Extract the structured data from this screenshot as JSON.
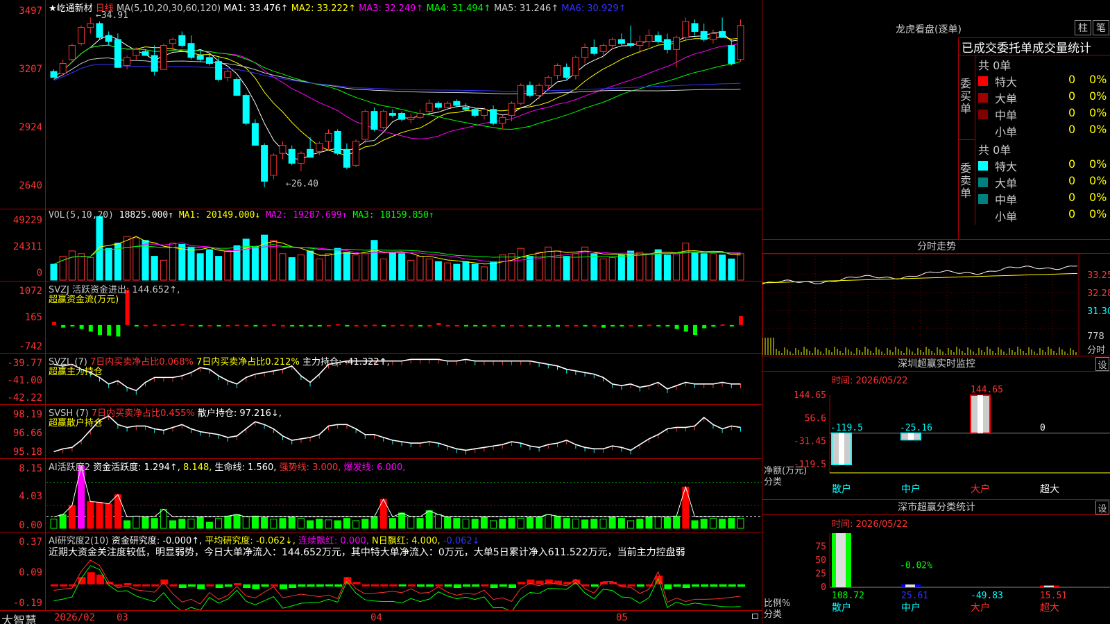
{
  "main": {
    "stock": "★屹通新材",
    "period": "日线",
    "ma_title": "MA(5,10,20,30,60,120)",
    "ma": [
      {
        "label": "MA1: 33.476↑",
        "color": "#ffffff"
      },
      {
        "label": "MA2: 33.222↑",
        "color": "#ffff00"
      },
      {
        "label": "MA3: 32.249↑",
        "color": "#ff00ff"
      },
      {
        "label": "MA4: 31.494↑",
        "color": "#00ff00"
      },
      {
        "label": "MA5: 31.246↑",
        "color": "#cccccc"
      },
      {
        "label": "MA6: 30.929↑",
        "color": "#3333ff"
      }
    ],
    "yticks": [
      "3497",
      "3207",
      "2924",
      "2640"
    ],
    "high_note": "34.91",
    "low_note": "26.40"
  },
  "volume": {
    "title": "VOL(5,10,20)",
    "value": "18825.000↑",
    "ma": [
      {
        "label": "MA1: 20149.000↓",
        "color": "#ffff00"
      },
      {
        "label": "MA2: 19287.699↑",
        "color": "#ff00ff"
      },
      {
        "label": "MA3: 18159.850↑",
        "color": "#00ff00"
      }
    ],
    "yticks": [
      "49229",
      "24311",
      "0"
    ]
  },
  "svzj": {
    "title": "SVZJ  活跃资金进出: 144.652↑,",
    "subtitle": "超赢资金流(万元)",
    "yticks": [
      "1072",
      "165",
      "-742"
    ]
  },
  "svzl": {
    "title": "SVZL (7)",
    "item1": "7日内买卖净占比0.068%",
    "item2": "7日内买卖净占比0.212%",
    "item3": "主力持仓: -41.322↑,",
    "subtitle": "超赢主力持仓",
    "yticks": [
      "-39.77",
      "-41.00",
      "-42.22"
    ]
  },
  "svsh": {
    "title": "SVSH (7)",
    "item1": "7日内买卖净占比0.455%",
    "item2": "散户持仓: 97.216↓,",
    "subtitle": "超赢散户持仓",
    "yticks": [
      "98.19",
      "96.66",
      "95.18"
    ]
  },
  "ai1": {
    "title": "AI活跃度2",
    "item1": "资金活跃度: 1.294↑,",
    "item2": "8.148,",
    "item3": "生命线: 1.560,",
    "item4": "强势线: 3.000,",
    "item5": "爆发线: 6.000,",
    "yticks": [
      "8.15",
      "4.03",
      "0.00"
    ]
  },
  "ai2": {
    "title": "AI研究度2(10)",
    "item1": "资金研究度: -0.000↑,",
    "item2": "平均研究度: -0.062↓,",
    "item3": "连续飘红: 0.000,",
    "item4": "N日飘红: 4.000,",
    "item5": "-0.062↓",
    "comment": "近期大资金关注度较低，明显弱势，今日大单净流入：144.652万元，其中特大单净流入：0万元，大单5日累计净入611.522万元，当前主力控盘弱",
    "yticks": [
      "0.37",
      "0.09",
      "-0.19"
    ]
  },
  "xaxis": {
    "brand": "大智慧",
    "labels": [
      "2026/02",
      "03",
      "04",
      "05"
    ]
  },
  "longhu": {
    "title": "龙虎看盘(逐单)",
    "btn1": "柱",
    "btn2": "笔",
    "tabs": "已成交委托单成交量统计",
    "buy_label": "委买单",
    "sell_label": "委卖单",
    "buy_total": "共 0单",
    "sell_total": "共 0单",
    "buy_rows": [
      {
        "name": "特大",
        "v": "0",
        "p": "0%",
        "color": "#ff0000"
      },
      {
        "name": "大单",
        "v": "0",
        "p": "0%",
        "color": "#a00000"
      },
      {
        "name": "中单",
        "v": "0",
        "p": "0%",
        "color": "#800000"
      },
      {
        "name": "小单",
        "v": "0",
        "p": "0%",
        "color": ""
      }
    ],
    "sell_rows": [
      {
        "name": "特大",
        "v": "0",
        "p": "0%",
        "color": "#00ffff"
      },
      {
        "name": "大单",
        "v": "0",
        "p": "0%",
        "color": "#008080"
      },
      {
        "name": "中单",
        "v": "0",
        "p": "0%",
        "color": "#008080"
      },
      {
        "name": "小单",
        "v": "0",
        "p": "0%",
        "color": ""
      }
    ]
  },
  "intraday": {
    "title": "分时走势",
    "yticks": [
      "33.25",
      "32.28",
      "31.30"
    ],
    "vol_tick": "778",
    "vol_label": "分时"
  },
  "monitor": {
    "title": "深圳超赢实时监控",
    "set": "设",
    "time": "时间: 2026/05/22",
    "yticks": [
      "144.65",
      "56.6",
      "-31.45",
      "-119.5"
    ],
    "ylabel": "净额(万元)",
    "xlabel": "分类",
    "bars": [
      {
        "cat": "散户",
        "value": "-119.5"
      },
      {
        "cat": "中户",
        "value": "-25.16"
      },
      {
        "cat": "大户",
        "value": "144.65"
      },
      {
        "cat": "超大",
        "value": "0"
      }
    ]
  },
  "stats": {
    "title": "深市超赢分类统计",
    "set": "设",
    "time": "时间: 2026/05/22",
    "yticks": [
      "75",
      "50",
      "25",
      "0"
    ],
    "ylabel": "比例%",
    "xlabel": "分类",
    "top_label": "-0.02%",
    "bars": [
      {
        "cat": "散户",
        "value": "108.72"
      },
      {
        "cat": "中户",
        "value": "25.61"
      },
      {
        "cat": "大户",
        "value": "-49.83"
      },
      {
        "cat": "超大",
        "value": "15.51"
      }
    ]
  },
  "chart_data": [
    {
      "type": "candlestick",
      "title": "★屹通新材 日线",
      "ylim": [
        25.5,
        35.5
      ],
      "ohlc": [
        [
          32.2,
          32.3,
          31.9,
          31.9
        ],
        [
          32.1,
          32.8,
          32.0,
          32.6
        ],
        [
          32.8,
          33.6,
          32.7,
          33.5
        ],
        [
          33.6,
          34.5,
          33.5,
          34.4
        ],
        [
          34.4,
          34.9,
          34.1,
          34.6
        ],
        [
          34.6,
          34.7,
          33.8,
          33.9
        ],
        [
          34.0,
          34.2,
          33.5,
          33.7
        ],
        [
          33.8,
          34.1,
          32.4,
          32.4
        ],
        [
          32.5,
          33.0,
          32.3,
          32.9
        ],
        [
          33.0,
          33.4,
          32.8,
          33.3
        ],
        [
          33.2,
          33.3,
          33.0,
          33.0
        ],
        [
          33.0,
          33.5,
          32.0,
          32.2
        ],
        [
          32.3,
          33.6,
          32.3,
          33.5
        ],
        [
          33.6,
          33.9,
          33.2,
          33.8
        ],
        [
          34.0,
          34.2,
          33.4,
          33.5
        ],
        [
          33.6,
          34.0,
          32.8,
          32.9
        ],
        [
          33.0,
          33.3,
          32.7,
          32.8
        ],
        [
          32.9,
          33.1,
          32.5,
          32.6
        ],
        [
          32.7,
          32.9,
          31.7,
          31.8
        ],
        [
          31.9,
          32.3,
          31.7,
          32.2
        ],
        [
          31.8,
          31.9,
          31.0,
          31.0
        ],
        [
          31.0,
          31.1,
          29.5,
          29.6
        ],
        [
          29.6,
          29.8,
          28.5,
          28.5
        ],
        [
          28.5,
          28.6,
          26.4,
          26.7
        ],
        [
          27.0,
          28.1,
          26.8,
          28.0
        ],
        [
          28.1,
          28.7,
          27.8,
          28.5
        ],
        [
          28.3,
          28.5,
          27.5,
          27.6
        ],
        [
          27.6,
          28.2,
          27.2,
          28.1
        ],
        [
          28.3,
          28.9,
          27.9,
          27.9
        ],
        [
          28.2,
          28.7,
          28.0,
          28.6
        ],
        [
          28.7,
          29.3,
          28.3,
          29.1
        ],
        [
          29.2,
          29.3,
          28.0,
          28.1
        ],
        [
          28.3,
          28.6,
          27.3,
          27.4
        ],
        [
          27.5,
          28.8,
          27.4,
          28.7
        ],
        [
          28.8,
          30.3,
          28.6,
          30.2
        ],
        [
          30.2,
          30.4,
          29.2,
          29.3
        ],
        [
          29.4,
          30.3,
          29.3,
          30.2
        ],
        [
          30.1,
          30.3,
          29.9,
          30.0
        ],
        [
          30.1,
          30.2,
          29.7,
          29.8
        ],
        [
          29.8,
          30.1,
          29.6,
          29.9
        ],
        [
          29.9,
          30.3,
          29.8,
          30.1
        ],
        [
          30.2,
          30.8,
          30.1,
          30.6
        ],
        [
          30.6,
          30.7,
          30.3,
          30.4
        ],
        [
          30.4,
          30.7,
          30.3,
          30.6
        ],
        [
          30.7,
          30.8,
          30.4,
          30.5
        ],
        [
          30.4,
          30.6,
          30.2,
          30.3
        ],
        [
          30.3,
          30.4,
          29.9,
          30.0
        ],
        [
          30.0,
          30.4,
          29.8,
          30.3
        ],
        [
          30.3,
          30.5,
          29.5,
          29.6
        ],
        [
          29.6,
          30.0,
          29.3,
          29.9
        ],
        [
          30.0,
          30.7,
          29.7,
          30.6
        ],
        [
          30.6,
          31.6,
          30.5,
          31.5
        ],
        [
          31.5,
          31.7,
          30.9,
          31.0
        ],
        [
          31.0,
          31.6,
          30.8,
          31.5
        ],
        [
          31.5,
          32.0,
          31.3,
          31.9
        ],
        [
          32.0,
          32.6,
          31.8,
          32.5
        ],
        [
          32.4,
          32.6,
          31.8,
          31.9
        ],
        [
          32.0,
          33.0,
          31.8,
          32.9
        ],
        [
          32.9,
          33.6,
          32.6,
          33.4
        ],
        [
          33.4,
          33.8,
          33.0,
          33.1
        ],
        [
          33.2,
          33.6,
          32.9,
          33.5
        ],
        [
          33.5,
          33.9,
          33.3,
          33.8
        ],
        [
          33.8,
          34.1,
          33.5,
          33.6
        ],
        [
          33.6,
          34.5,
          33.4,
          33.5
        ],
        [
          33.5,
          34.0,
          33.1,
          33.7
        ],
        [
          33.7,
          34.3,
          33.4,
          34.0
        ],
        [
          34.0,
          34.2,
          33.6,
          33.7
        ],
        [
          33.8,
          34.1,
          33.1,
          33.3
        ],
        [
          33.3,
          34.0,
          32.4,
          33.9
        ],
        [
          33.9,
          34.9,
          33.7,
          34.7
        ],
        [
          34.6,
          34.8,
          34.0,
          34.2
        ],
        [
          34.2,
          34.6,
          33.7,
          33.8
        ],
        [
          33.8,
          34.3,
          33.6,
          34.1
        ],
        [
          34.2,
          34.9,
          34.0,
          33.9
        ],
        [
          33.5,
          33.8,
          32.5,
          32.6
        ],
        [
          32.8,
          34.8,
          32.7,
          34.5
        ]
      ]
    },
    {
      "type": "bar",
      "title": "VOL(5,10,20)",
      "ylim": [
        0,
        49229
      ],
      "values": [
        12,
        18,
        22,
        20,
        17,
        48,
        24,
        28,
        33,
        32,
        30,
        18,
        15,
        28,
        27,
        25,
        20,
        23,
        18,
        22,
        26,
        31,
        25,
        34,
        30,
        20,
        17,
        19,
        22,
        16,
        20,
        24,
        21,
        19,
        20,
        30,
        16,
        21,
        20,
        15,
        18,
        16,
        14,
        13,
        12,
        14,
        12,
        10,
        14,
        19,
        20,
        24,
        18,
        21,
        25,
        22,
        18,
        20,
        25,
        20,
        16,
        17,
        19,
        22,
        21,
        20,
        23,
        19,
        20,
        28,
        21,
        20,
        20,
        19,
        16,
        20
      ]
    },
    {
      "type": "bar",
      "title": "SVZJ",
      "ylim": [
        -742,
        1072
      ],
      "values": [
        100,
        -80,
        -30,
        -120,
        -200,
        -300,
        -320,
        -350,
        1072,
        -10,
        0,
        20,
        0,
        15,
        30,
        0,
        -20,
        0,
        -10,
        0,
        10,
        0,
        -5,
        0,
        20,
        0,
        -15,
        -5,
        -30,
        -5,
        0,
        30,
        -20,
        0,
        0,
        10,
        -20,
        0,
        10,
        0,
        -40,
        0,
        60,
        0,
        0,
        -25,
        -30,
        -5,
        0,
        -15,
        0,
        0,
        -20,
        -25,
        -35,
        -50,
        0,
        0,
        -20,
        0,
        -80,
        -20,
        -10,
        0,
        -15,
        10,
        -25,
        -15,
        -120,
        -200,
        -300,
        -100,
        -50,
        20,
        -20,
        270,
        -25,
        -10,
        -15,
        20
      ]
    },
    {
      "type": "line",
      "title": "SVZL",
      "ylim": [
        -42.22,
        -39.77
      ],
      "values": [
        -40.0,
        -40.1,
        -40.0,
        -40.3,
        -40.5,
        -40.8,
        -41.2,
        -41.0,
        -41.4,
        -41.6,
        -41.1,
        -40.8,
        -40.8,
        -40.8,
        -40.7,
        -40.5,
        -40.2,
        -40.3,
        -40.7,
        -41.0,
        -41.2,
        -40.8,
        -40.6,
        -40.5,
        -40.4,
        -40.3,
        -40.1,
        -40.7,
        -41.1,
        -40.6,
        -40.0,
        -39.9,
        -39.8,
        -39.8,
        -39.8,
        -39.8,
        -39.8,
        -39.8,
        -39.8,
        -39.7,
        -39.7,
        -39.7,
        -39.7,
        -39.8,
        -39.8,
        -39.7,
        -39.8,
        -39.8,
        -39.8,
        -39.8,
        -39.8,
        -39.8,
        -39.8,
        -39.9,
        -40.0,
        -40.1,
        -40.3,
        -40.4,
        -40.5,
        -40.6,
        -40.8,
        -41.2,
        -41.3,
        -41.2,
        -41.4,
        -41.3,
        -41.1,
        -41.5,
        -41.3,
        -41.1,
        -41.2,
        -41.2,
        -41.2,
        -41.1,
        -41.2,
        -41.2
      ]
    },
    {
      "type": "line",
      "title": "SVSH",
      "ylim": [
        95.18,
        98.19
      ],
      "values": [
        95.4,
        95.6,
        95.7,
        96.2,
        96.9,
        97.6,
        97.9,
        97.3,
        97.1,
        97.2,
        97.2,
        97.0,
        96.9,
        97.1,
        97.3,
        97.0,
        96.8,
        96.7,
        96.6,
        96.4,
        96.5,
        97.0,
        97.5,
        97.3,
        97.0,
        96.5,
        96.2,
        96.3,
        96.4,
        96.6,
        97.2,
        97.3,
        97.3,
        97.0,
        96.6,
        96.6,
        96.4,
        96.2,
        96.1,
        96.0,
        96.0,
        96.1,
        96.0,
        95.8,
        95.6,
        95.5,
        95.6,
        95.7,
        95.8,
        95.9,
        96.1,
        96.0,
        95.8,
        95.7,
        95.9,
        96.0,
        96.2,
        95.9,
        95.7,
        95.6,
        95.6,
        95.8,
        95.7,
        95.5,
        95.9,
        96.3,
        96.6,
        97.0,
        97.1,
        97.1,
        97.2,
        97.8,
        97.3,
        97.0,
        97.2,
        97.1
      ]
    },
    {
      "type": "bar",
      "title": "AI活跃度2",
      "ylim": [
        0,
        8.15
      ],
      "values": [
        1.2,
        1.8,
        3.0,
        8.15,
        3.5,
        3.4,
        3.2,
        4.4,
        1.0,
        1.6,
        1.5,
        1.3,
        2.5,
        1.0,
        1.2,
        1.2,
        1.5,
        0.8,
        1.3,
        1.6,
        1.8,
        1.5,
        1.6,
        1.4,
        1.2,
        1.3,
        1.5,
        1.3,
        1.0,
        1.2,
        1.1,
        1.0,
        1.3,
        1.0,
        1.2,
        1.5,
        3.8,
        1.3,
        2.0,
        1.5,
        1.3,
        2.3,
        1.8,
        1.5,
        1.3,
        1.2,
        1.2,
        1.5,
        1.0,
        1.2,
        1.3,
        1.3,
        1.4,
        1.5,
        1.8,
        1.6,
        1.3,
        1.2,
        1.1,
        1.2,
        1.2,
        1.5,
        1.3,
        1.0,
        1.2,
        1.5,
        1.5,
        1.4,
        1.6,
        5.4,
        1.0,
        1.2,
        1.3,
        1.2,
        1.3,
        1.3
      ]
    },
    {
      "type": "bar",
      "title": "AI研究度2(10)",
      "ylim": [
        -0.19,
        0.37
      ],
      "values": [
        0.0,
        0.0,
        0.0,
        0.06,
        0.1,
        0.08,
        0.02,
        0.0,
        0.01,
        0.0,
        0.0,
        0.0,
        0.04,
        0.0,
        -0.03,
        -0.02,
        -0.04,
        0.0,
        -0.03,
        -0.02,
        0.01,
        -0.03,
        -0.04,
        -0.02,
        0.0,
        -0.04,
        -0.03,
        -0.02,
        -0.02,
        -0.02,
        -0.01,
        -0.02,
        0.06,
        0.02,
        0.0,
        0.0,
        0.0,
        0.0,
        -0.01,
        0.0,
        -0.02,
        -0.02,
        0.0,
        -0.02,
        -0.03,
        -0.02,
        -0.02,
        0.0,
        -0.03,
        -0.02,
        -0.03,
        0.02,
        0.04,
        0.03,
        0.04,
        0.03,
        0.02,
        0.04,
        0.0,
        -0.02,
        0.02,
        0.02,
        0.0,
        0.0,
        -0.02,
        0.0,
        0.07,
        -0.04,
        -0.02,
        -0.03,
        -0.02,
        -0.02,
        -0.02,
        -0.02,
        -0.02,
        -0.02
      ]
    }
  ]
}
